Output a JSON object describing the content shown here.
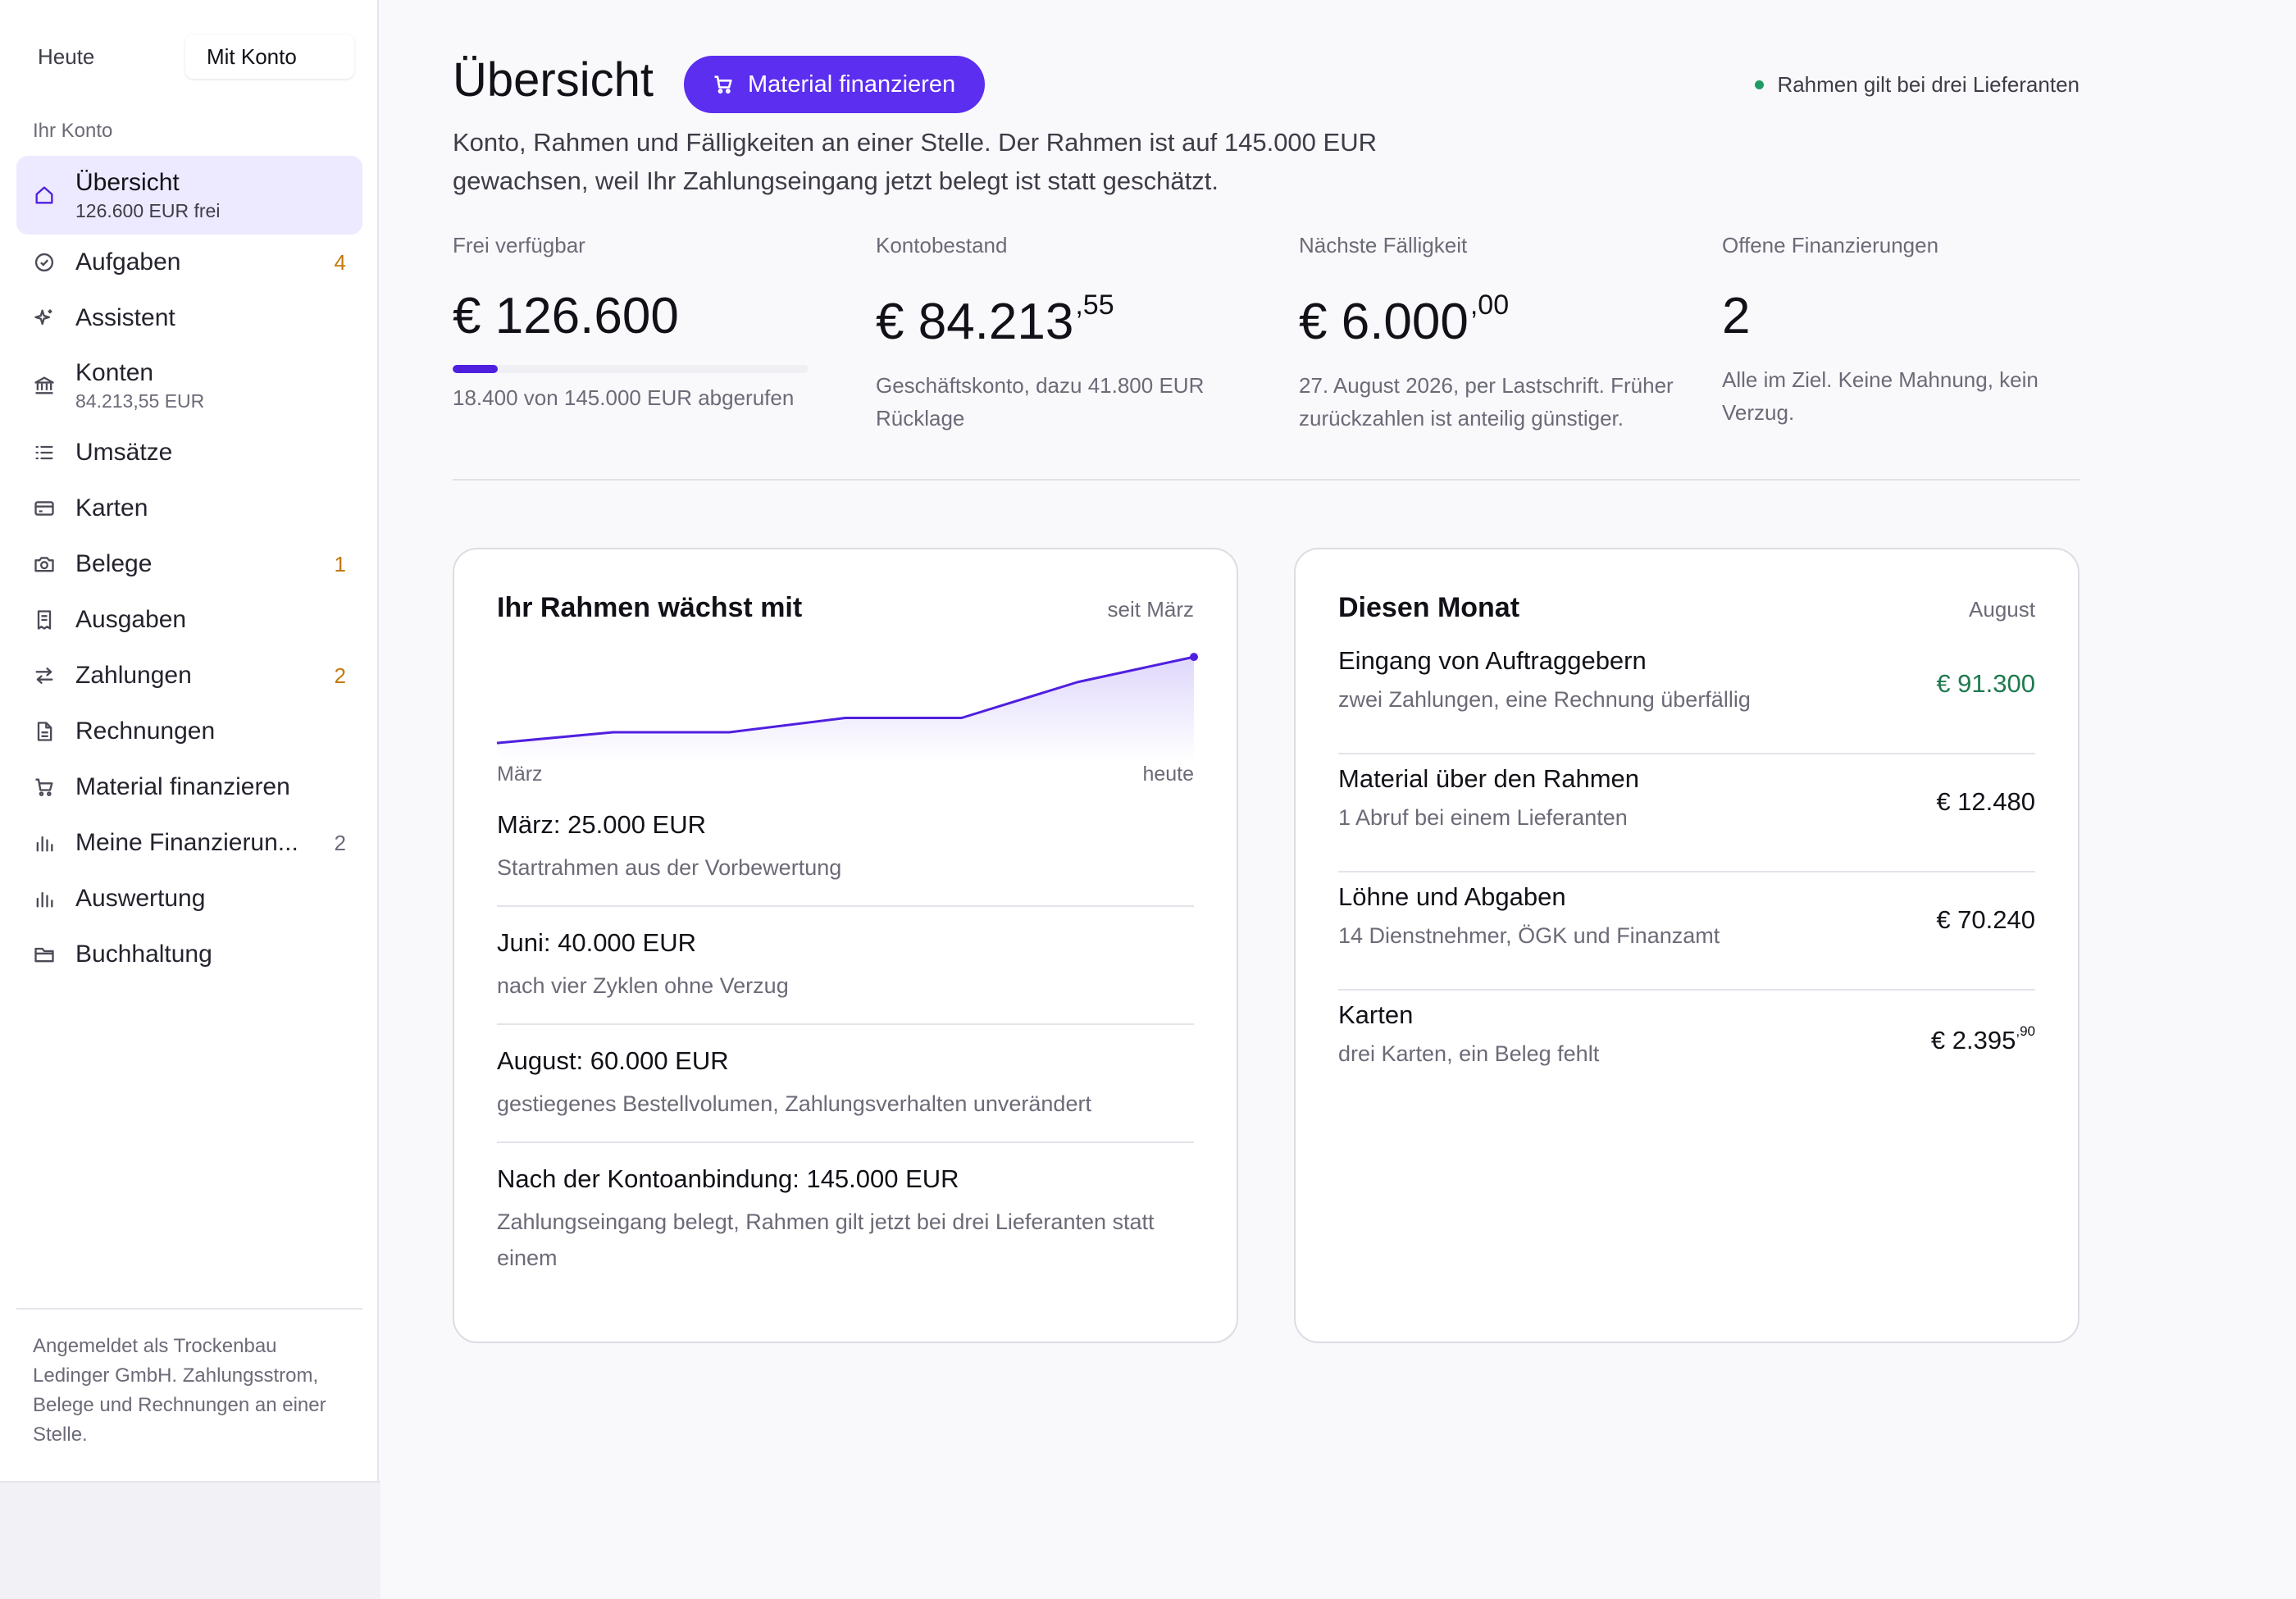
{
  "sidebar": {
    "mode_tabs": [
      "Heute",
      "Mit Konto"
    ],
    "section_label": "Ihr Konto",
    "items": [
      {
        "label": "Übersicht",
        "sub": "126.600 EUR frei",
        "badge": "",
        "icon": "home-icon",
        "active": true
      },
      {
        "label": "Aufgaben",
        "sub": "",
        "badge": "4",
        "icon": "check-circle-icon"
      },
      {
        "label": "Assistent",
        "sub": "",
        "badge": "",
        "icon": "sparkle-icon"
      },
      {
        "label": "Konten",
        "sub": "84.213,55 EUR",
        "badge": "",
        "icon": "bank-icon"
      },
      {
        "label": "Umsätze",
        "sub": "",
        "badge": "",
        "icon": "list-icon"
      },
      {
        "label": "Karten",
        "sub": "",
        "badge": "",
        "icon": "card-icon"
      },
      {
        "label": "Belege",
        "sub": "",
        "badge": "1",
        "icon": "camera-icon"
      },
      {
        "label": "Ausgaben",
        "sub": "",
        "badge": "",
        "icon": "receipt-icon"
      },
      {
        "label": "Zahlungen",
        "sub": "",
        "badge": "2",
        "icon": "transfer-icon"
      },
      {
        "label": "Rechnungen",
        "sub": "",
        "badge": "",
        "icon": "document-icon"
      },
      {
        "label": "Material finanzieren",
        "sub": "",
        "badge": "",
        "icon": "cart-icon"
      },
      {
        "label": "Meine Finanzierun...",
        "sub": "",
        "badge": "2",
        "icon": "bar-chart-icon"
      },
      {
        "label": "Auswertung",
        "sub": "",
        "badge": "",
        "icon": "bar-chart-icon"
      },
      {
        "label": "Buchhaltung",
        "sub": "",
        "badge": "",
        "icon": "folder-icon"
      }
    ],
    "footer": "Angemeldet als Trockenbau Ledinger GmbH. Zahlungsstrom, Belege und Rechnungen an einer Stelle."
  },
  "header": {
    "title": "Übersicht",
    "cta_label": "Material finanzieren",
    "status_note": "Rahmen gilt bei drei Lieferanten",
    "intro": "Konto, Rahmen und Fälligkeiten an einer Stelle. Der Rahmen ist auf 145.000 EUR gewachsen, weil Ihr Zahlungseingang jetzt belegt ist statt geschätzt."
  },
  "stats": {
    "available": {
      "label": "Frei verfügbar",
      "value": "€ 126.600",
      "desc": "18.400 von 145.000 EUR abgerufen",
      "used": 18400,
      "total": 145000
    },
    "balance": {
      "label": "Kontobestand",
      "value": "€ 84.213",
      "cents": ",55",
      "desc": "Geschäftskonto, dazu 41.800 EUR Rücklage"
    },
    "due": {
      "label": "Nächste Fälligkeit",
      "value": "€ 6.000",
      "cents": ",00",
      "desc": "27. August 2026, per Lastschrift. Früher zurückzahlen ist anteilig günstiger."
    },
    "open": {
      "label": "Offene Finanzierungen",
      "value": "2",
      "desc": "Alle im Ziel. Keine Mahnung, kein Verzug."
    }
  },
  "growth_card": {
    "title": "Ihr Rahmen wächst mit",
    "meta": "seit März",
    "x_start": "März",
    "x_end": "heute",
    "milestones": [
      {
        "title": "März: 25.000 EUR",
        "desc": "Startrahmen aus der Vorbewertung"
      },
      {
        "title": "Juni: 40.000 EUR",
        "desc": "nach vier Zyklen ohne Verzug"
      },
      {
        "title": "August: 60.000 EUR",
        "desc": "gestiegenes Bestellvolumen, Zahlungsverhalten unverändert"
      },
      {
        "title": "Nach der Kontoanbindung: 145.000 EUR",
        "desc": "Zahlungseingang belegt, Rahmen gilt jetzt bei drei Lieferanten statt einem"
      }
    ]
  },
  "chart_data": {
    "type": "area",
    "title": "",
    "x_labels_shown": [
      "März",
      "heute"
    ],
    "values": [
      25000,
      40000,
      40000,
      60000,
      60000,
      110000,
      145000
    ],
    "ylim": [
      0,
      160000
    ],
    "grid": false,
    "color": "#4f1fe0"
  },
  "month_card": {
    "title": "Diesen Monat",
    "meta": "August",
    "rows": [
      {
        "title": "Eingang von Auftraggebern",
        "desc": "zwei Zahlungen, eine Rechnung überfällig",
        "amount": "€ 91.300",
        "cents": "",
        "positive": true
      },
      {
        "title": "Material über den Rahmen",
        "desc": "1 Abruf bei einem Lieferanten",
        "amount": "€ 12.480",
        "cents": ""
      },
      {
        "title": "Löhne und Abgaben",
        "desc": "14 Dienstnehmer, ÖGK und Finanzamt",
        "amount": "€ 70.240",
        "cents": ""
      },
      {
        "title": "Karten",
        "desc": "drei Karten, ein Beleg fehlt",
        "amount": "€ 2.395",
        "cents": ",90"
      }
    ]
  },
  "colors": {
    "accent": "#5b2ef0",
    "positive": "#1f7a4f",
    "badge": "#c2790a",
    "status": "#1f9d64"
  }
}
